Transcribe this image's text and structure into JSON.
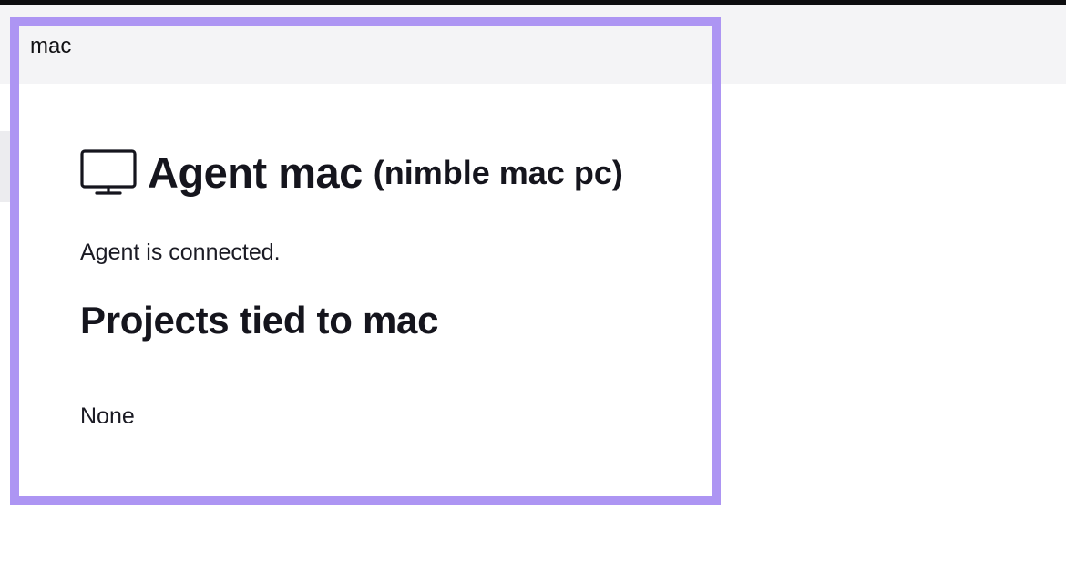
{
  "panel": {
    "header_title": "mac"
  },
  "agent": {
    "icon": "monitor-icon",
    "title": "Agent mac",
    "subtitle": "(nimble mac pc)",
    "status": "Agent is connected."
  },
  "projects": {
    "heading": "Projects tied to mac",
    "value": "None"
  },
  "colors": {
    "highlight_border": "#ad95f3",
    "header_bg": "#f4f4f6",
    "text": "#15151d"
  }
}
